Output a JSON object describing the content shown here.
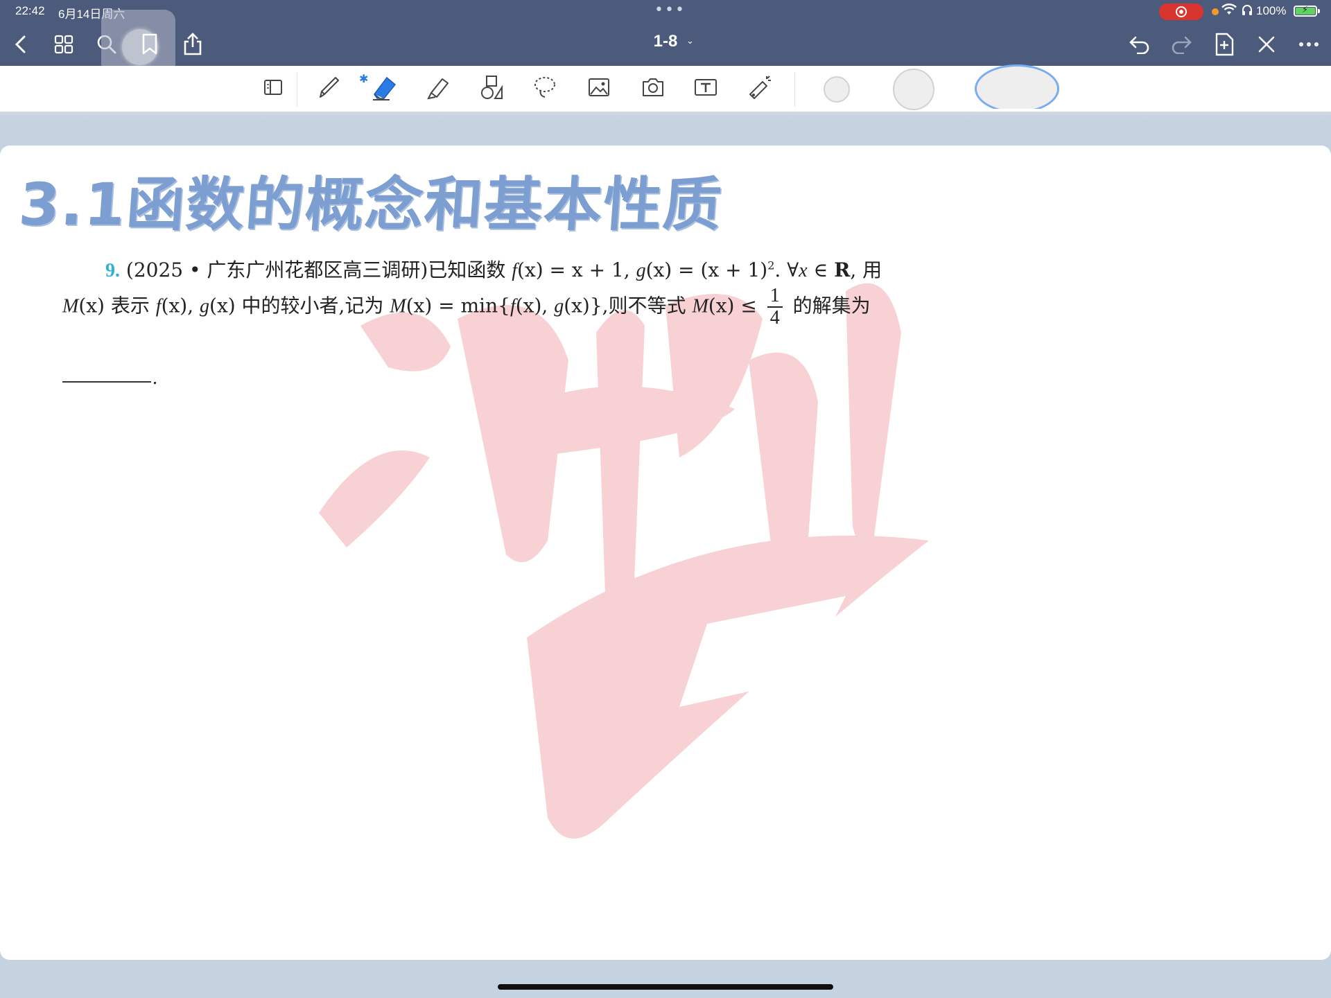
{
  "status_bar": {
    "time": "22:42",
    "date": "6月14日周六",
    "dots": "•••",
    "battery_percent": "100%",
    "colors": {
      "record": "#d9342f",
      "battery": "#5fd35f",
      "privacy_dot": "#f39a2a"
    }
  },
  "nav": {
    "document_title": "1-8",
    "chevron": "⌄",
    "icons": [
      "back-icon",
      "grid-icon",
      "search-icon",
      "bookmark-icon",
      "share-icon",
      "undo-icon",
      "redo-icon",
      "add-page-icon",
      "close-pen-icon",
      "more-icon"
    ]
  },
  "toolbar": {
    "tools": [
      "reader-mode-icon",
      "pen-icon",
      "eraser-icon",
      "highlighter-icon",
      "shapes-icon",
      "lasso-icon",
      "image-icon",
      "camera-icon",
      "text-box-icon",
      "laser-pointer-icon"
    ],
    "bluetooth_glyph": "✱",
    "active_color": "#2a7ce4"
  },
  "page": {
    "section_title": "3.1函数的概念和基本性质",
    "section_color": "#7c9ed0",
    "problem": {
      "number": "9.",
      "line1_source": "(2025 • 广东广州花都区高三调研)已知函数 ",
      "line1_f": "f",
      "line1_math1": "(x) = x + 1, ",
      "line1_g": "g",
      "line1_math2": "(x) = (x + 1)",
      "line1_sup": "2",
      "line1_forall": ". ∀",
      "line1_x": "x",
      "line1_in": " ∈ ",
      "line1_R": "R",
      "line1_end": ", 用",
      "line2_M": "M",
      "line2_a": "(x) 表示 ",
      "line2_f": "f",
      "line2_b": "(x), ",
      "line2_g": "g",
      "line2_c": "(x) 中的较小者,记为 ",
      "line2_M2": "M",
      "line2_d": "(x) = min{",
      "line2_f2": "f",
      "line2_e": "(x), ",
      "line2_g2": "g",
      "line2_h": "(x)},则不等式 ",
      "line2_M3": "M",
      "line2_i": "(x) ≤ ",
      "frac_num": "1",
      "frac_den": "4",
      "line2_end": " 的解集为",
      "blank_end": "."
    },
    "watermark_color": "#f6c9cc"
  }
}
